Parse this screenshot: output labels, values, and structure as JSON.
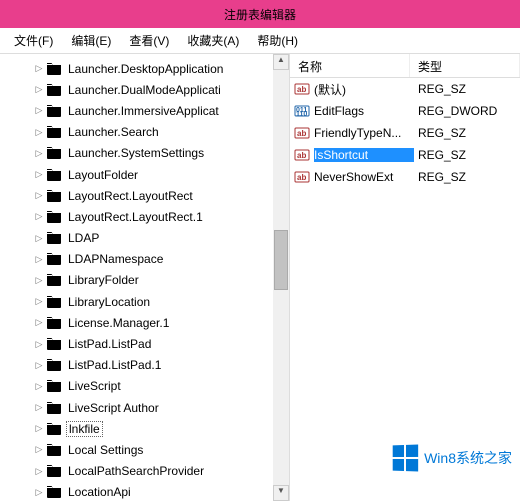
{
  "window": {
    "title": "注册表编辑器"
  },
  "menu": {
    "file": "文件(F)",
    "edit": "编辑(E)",
    "view": "查看(V)",
    "favorites": "收藏夹(A)",
    "help": "帮助(H)"
  },
  "tree": {
    "items": [
      {
        "label": "Launcher.DesktopApplication"
      },
      {
        "label": "Launcher.DualModeApplicati"
      },
      {
        "label": "Launcher.ImmersiveApplicat"
      },
      {
        "label": "Launcher.Search"
      },
      {
        "label": "Launcher.SystemSettings"
      },
      {
        "label": "LayoutFolder"
      },
      {
        "label": "LayoutRect.LayoutRect"
      },
      {
        "label": "LayoutRect.LayoutRect.1"
      },
      {
        "label": "LDAP"
      },
      {
        "label": "LDAPNamespace"
      },
      {
        "label": "LibraryFolder"
      },
      {
        "label": "LibraryLocation"
      },
      {
        "label": "License.Manager.1"
      },
      {
        "label": "ListPad.ListPad"
      },
      {
        "label": "ListPad.ListPad.1"
      },
      {
        "label": "LiveScript"
      },
      {
        "label": "LiveScript Author"
      },
      {
        "label": "lnkfile",
        "selected": true
      },
      {
        "label": "Local Settings"
      },
      {
        "label": "LocalPathSearchProvider"
      },
      {
        "label": "LocationApi"
      }
    ]
  },
  "values": {
    "headers": {
      "name": "名称",
      "type": "类型"
    },
    "rows": [
      {
        "icon": "ab",
        "name": "(默认)",
        "type": "REG_SZ"
      },
      {
        "icon": "bin",
        "name": "EditFlags",
        "type": "REG_DWORD"
      },
      {
        "icon": "ab",
        "name": "FriendlyTypeN...",
        "type": "REG_SZ"
      },
      {
        "icon": "ab",
        "name": "IsShortcut",
        "type": "REG_SZ",
        "selected": true
      },
      {
        "icon": "ab",
        "name": "NeverShowExt",
        "type": "REG_SZ"
      }
    ]
  },
  "watermark": {
    "text": "Win8系统之家"
  }
}
